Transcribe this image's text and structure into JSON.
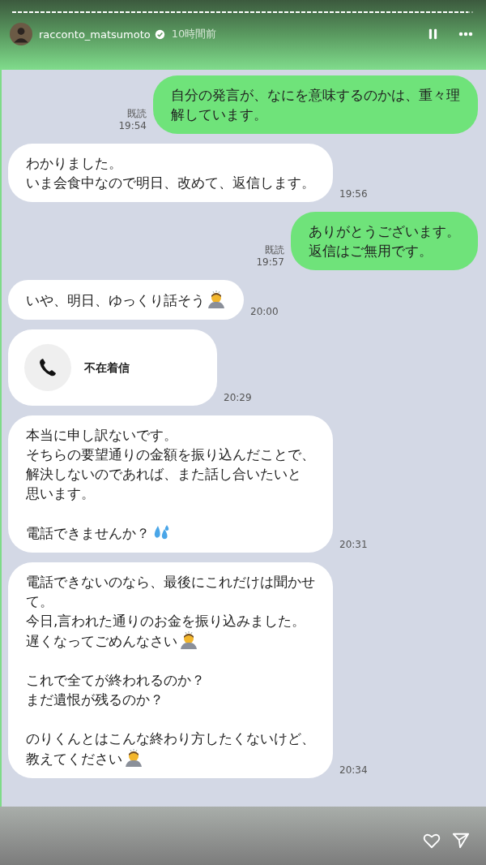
{
  "story_header": {
    "progress": {
      "level": 0.99
    },
    "username": "racconto_matsumoto",
    "verified": true,
    "posted": "10時間前"
  },
  "messages": [
    {
      "kind": "sent",
      "read": "既読",
      "time": "19:54",
      "paragraphs": [
        {
          "lines": [
            "自分の発言が、なにを意味するのかは、重々理",
            "解しています。"
          ]
        }
      ]
    },
    {
      "kind": "received",
      "time": "19:56",
      "paragraphs": [
        {
          "lines": [
            "わかりました。",
            "いま会食中なので明日、改めて、返信します。"
          ]
        }
      ]
    },
    {
      "kind": "sent",
      "read": "既読",
      "time": "19:57",
      "paragraphs": [
        {
          "lines": [
            "ありがとうございます。",
            "返信はご無用です。"
          ]
        }
      ]
    },
    {
      "kind": "received",
      "time": "20:00",
      "paragraphs": [
        {
          "lines": [
            "いや、明日、ゆっくり話そう"
          ],
          "kind": "bow"
        }
      ]
    },
    {
      "kind": "call",
      "label": "不在着信",
      "time": "20:29"
    },
    {
      "kind": "received",
      "time": "20:31",
      "paragraphs": [
        {
          "lines": [
            "本当に申し訳ないです。",
            "そちらの要望通りの金額を振り込んだことで、",
            "解決しないのであれば、また話し合いたいと",
            "思います。"
          ]
        },
        {
          "lines": [
            "電話できませんか？"
          ],
          "kind": "drops"
        }
      ]
    },
    {
      "kind": "received",
      "time": "20:34",
      "paragraphs": [
        {
          "lines": [
            "電話できないのなら、最後にこれだけは聞かせ",
            "て。",
            "今日,言われた通りのお金を振り込みました。",
            "遅くなってごめんなさい"
          ],
          "kind": "bow"
        },
        {
          "lines": [
            "これで全てが終われるのか？",
            "まだ遺恨が残るのか？"
          ]
        },
        {
          "lines": [
            "のりくんとはこんな終わり方したくないけど、",
            "教えてください"
          ],
          "kind": "bow"
        }
      ]
    }
  ]
}
